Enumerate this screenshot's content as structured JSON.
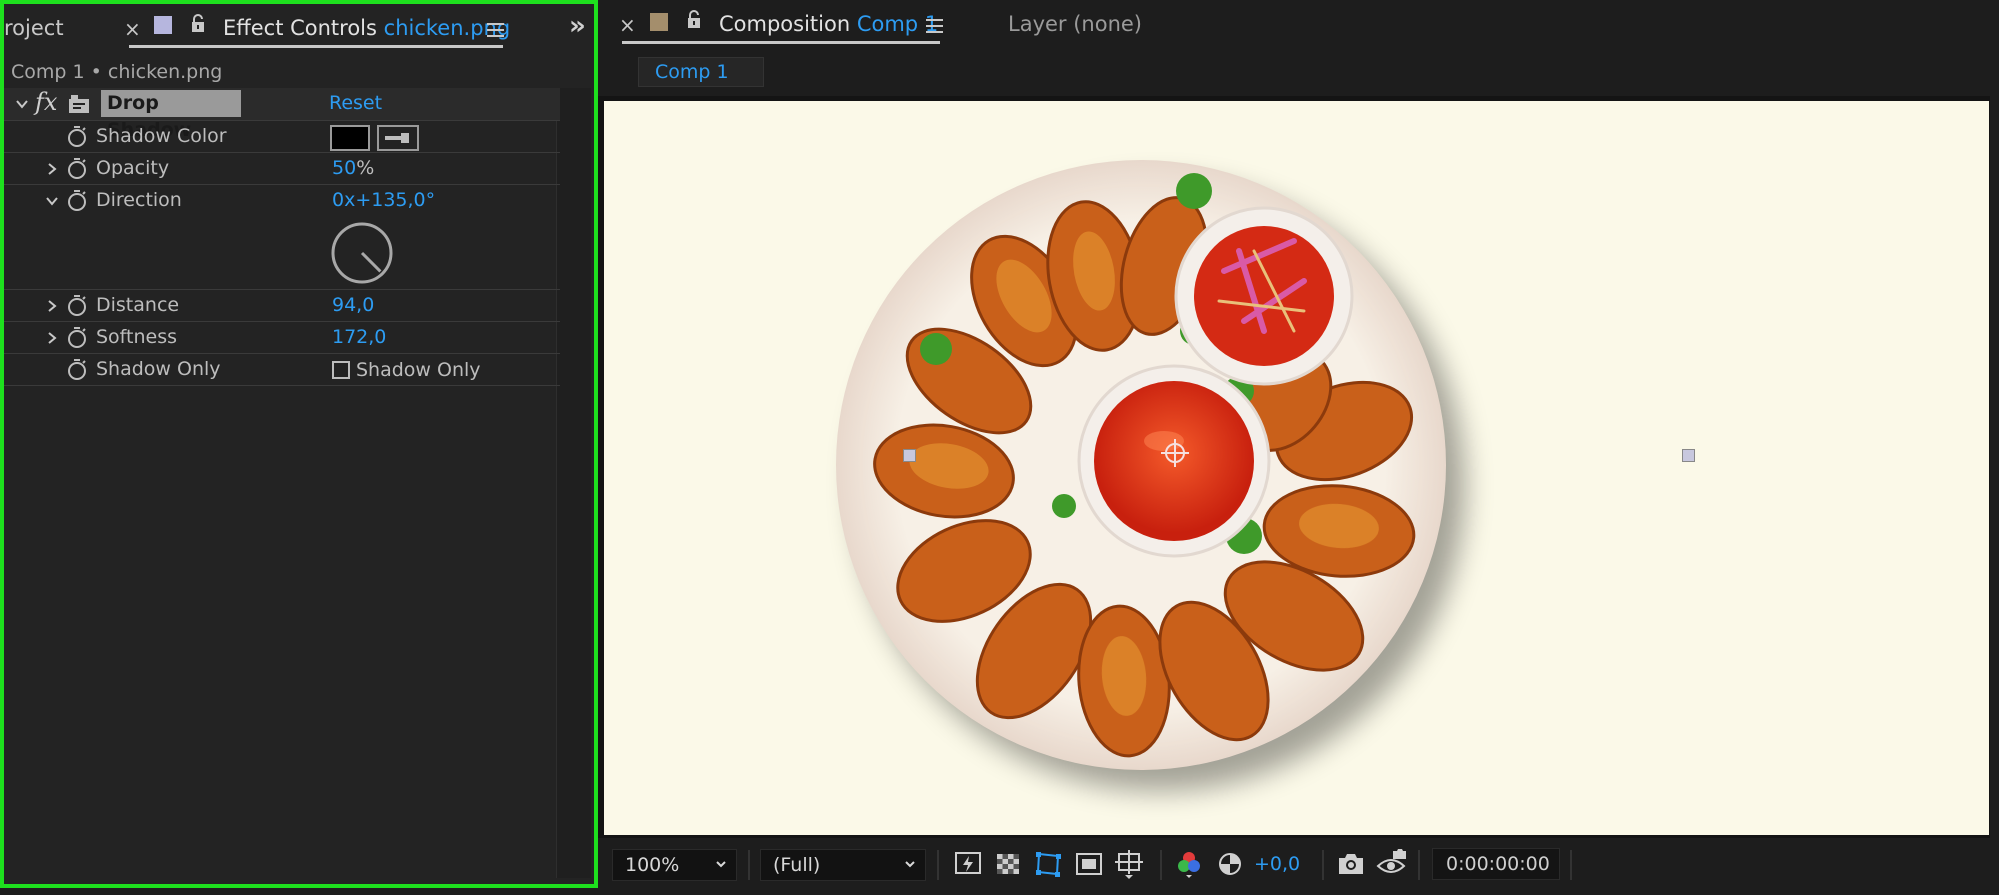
{
  "effect_panel": {
    "project_tab_label": "roject",
    "tab_label": "Effect Controls",
    "tab_layer_name": "chicken.png",
    "breadcrumb": "Comp 1 • chicken.png",
    "effect_name": "Drop Shadow",
    "reset_label": "Reset",
    "properties": {
      "shadow_color": {
        "label": "Shadow Color",
        "color": "#000000"
      },
      "opacity": {
        "label": "Opacity",
        "value": "50",
        "unit": "%"
      },
      "direction": {
        "label": "Direction",
        "value": "0x+135,0°",
        "angle_degrees": 135
      },
      "distance": {
        "label": "Distance",
        "value": "94,0"
      },
      "softness": {
        "label": "Softness",
        "value": "172,0"
      },
      "shadow_only": {
        "label": "Shadow Only",
        "checkbox_label": "Shadow Only",
        "checked": false
      }
    }
  },
  "composition_panel": {
    "tab_label": "Composition",
    "tab_comp_name": "Comp 1",
    "layer_tab_label": "Layer (none)",
    "sub_tab_label": "Comp 1",
    "canvas_color": "#fbf9e8"
  },
  "viewer_toolbar": {
    "zoom": "100%",
    "resolution": "(Full)",
    "exposure": "+0,0",
    "timecode": "0:00:00:00"
  },
  "colors": {
    "accent": "#2d9cf2",
    "panel_highlight_border": "#1ee01e",
    "panel_bg": "#232323"
  },
  "icons": [
    "close-icon",
    "label-color-swatch-icon",
    "lock-icon",
    "panel-menu-icon",
    "expand-panels-icon",
    "twirl-down-icon",
    "twirl-right-icon",
    "fx-icon",
    "effect-preset-icon",
    "stopwatch-icon",
    "eyedropper-icon",
    "checkbox-icon",
    "fast-previews-icon",
    "transparency-grid-icon",
    "mask-path-visibility-icon",
    "region-of-interest-icon",
    "grid-guides-icon",
    "color-channels-icon",
    "reset-exposure-icon",
    "snapshot-icon",
    "show-snapshot-icon"
  ]
}
